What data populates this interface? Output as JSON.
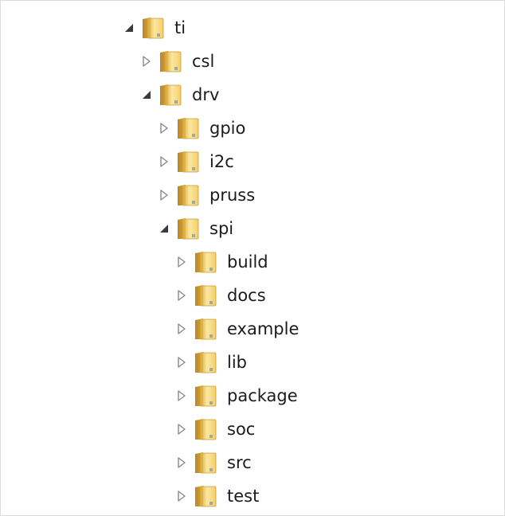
{
  "tree": {
    "nodes": [
      {
        "name": "ti",
        "depth": 0,
        "expanded": true
      },
      {
        "name": "csl",
        "depth": 1,
        "expanded": false
      },
      {
        "name": "drv",
        "depth": 1,
        "expanded": true
      },
      {
        "name": "gpio",
        "depth": 2,
        "expanded": false
      },
      {
        "name": "i2c",
        "depth": 2,
        "expanded": false
      },
      {
        "name": "pruss",
        "depth": 2,
        "expanded": false
      },
      {
        "name": "spi",
        "depth": 2,
        "expanded": true
      },
      {
        "name": "build",
        "depth": 3,
        "expanded": false
      },
      {
        "name": "docs",
        "depth": 3,
        "expanded": false
      },
      {
        "name": "example",
        "depth": 3,
        "expanded": false
      },
      {
        "name": "lib",
        "depth": 3,
        "expanded": false
      },
      {
        "name": "package",
        "depth": 3,
        "expanded": false
      },
      {
        "name": "soc",
        "depth": 3,
        "expanded": false
      },
      {
        "name": "src",
        "depth": 3,
        "expanded": false
      },
      {
        "name": "test",
        "depth": 3,
        "expanded": false
      }
    ]
  },
  "icons": {
    "folder": "folder-icon",
    "expanded": "expanded-arrow-icon",
    "collapsed": "collapsed-arrow-icon"
  },
  "colors": {
    "folder_light": "#fbe7a1",
    "folder_dark": "#d9a93a",
    "arrow_expanded": "#3a3a3a",
    "arrow_collapsed": "#8a8a8a",
    "text": "#1b1b1b"
  }
}
